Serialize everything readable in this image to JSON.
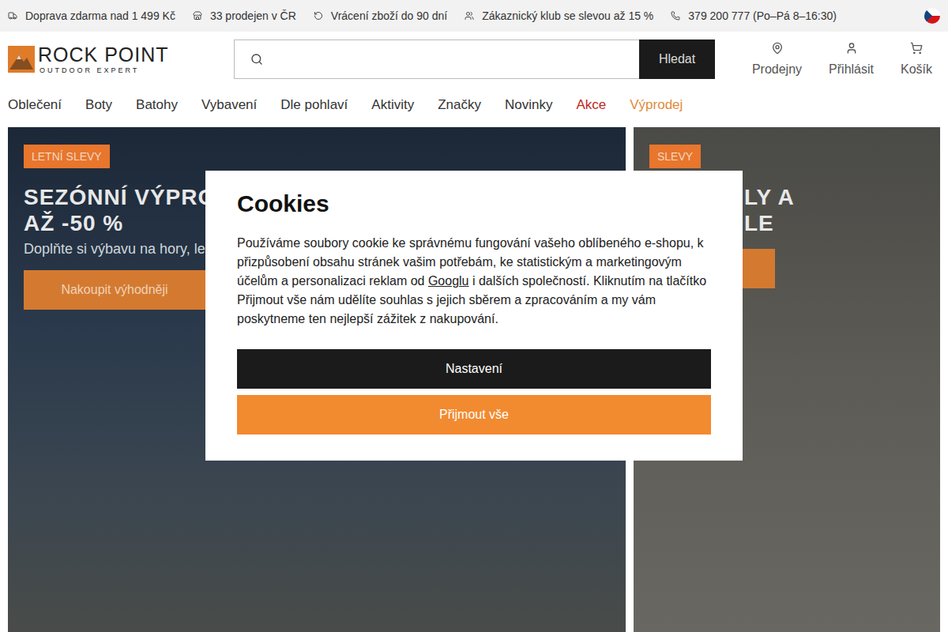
{
  "topbar": {
    "items": [
      {
        "text": "Doprava zdarma nad 1 499 Kč",
        "icon": "truck"
      },
      {
        "text": "33 prodejen v ČR",
        "icon": "store"
      },
      {
        "text": "Vrácení zboží do 90 dní",
        "icon": "return"
      },
      {
        "text": "Zákaznický klub se slevou až 15 %",
        "icon": "club"
      },
      {
        "text": "379 200 777 (Po–Pá 8–16:30)",
        "icon": "phone"
      }
    ]
  },
  "logo": {
    "name": "ROCK POINT",
    "tagline": "OUTDOOR EXPERT"
  },
  "search": {
    "placeholder": "",
    "button": "Hledat"
  },
  "header_links": [
    {
      "label": "Prodejny",
      "icon": "pin"
    },
    {
      "label": "Přihlásit",
      "icon": "user"
    },
    {
      "label": "Košík",
      "icon": "cart"
    }
  ],
  "nav": [
    {
      "label": "Oblečení",
      "color": "#333333"
    },
    {
      "label": "Boty",
      "color": "#333333"
    },
    {
      "label": "Batohy",
      "color": "#333333"
    },
    {
      "label": "Vybavení",
      "color": "#333333"
    },
    {
      "label": "Dle pohlaví",
      "color": "#333333"
    },
    {
      "label": "Aktivity",
      "color": "#333333"
    },
    {
      "label": "Značky",
      "color": "#333333"
    },
    {
      "label": "Novinky",
      "color": "#333333"
    },
    {
      "label": "Akce",
      "color": "#c0271f"
    },
    {
      "label": "Výprodej",
      "color": "#e08a3a"
    }
  ],
  "banners": {
    "main": {
      "badge": "LETNÍ SLEVY",
      "title": [
        "SEZÓNNÍ VÝPRO",
        "AŽ -50 %"
      ],
      "subtitle": "Doplňte si výbavu na hory, le",
      "button": "Nakoupit výhodněji"
    },
    "side": {
      "badge": "SLEVY",
      "title": [
        "LY A",
        "LE"
      ]
    }
  },
  "cookie_dialog": {
    "title": "Cookies",
    "text_before": "Používáme soubory cookie ke správnému fungování vašeho oblíbeného e-shopu, k přizpůsobení obsahu stránek vašim potřebám, ke statistickým a marketingovým účelům a personalizaci reklam od ",
    "link": "Googlu",
    "text_after": " i dalších společností. Kliknutím na tlačítko Přijmout vše nám udělíte souhlas s jejich sběrem a zpracováním a my vám poskytneme ten nejlepší zážitek z nakupování.",
    "buttons": [
      {
        "label": "Nastavení",
        "kind": "dark"
      },
      {
        "label": "Přijmout vše",
        "kind": "primary"
      }
    ]
  }
}
